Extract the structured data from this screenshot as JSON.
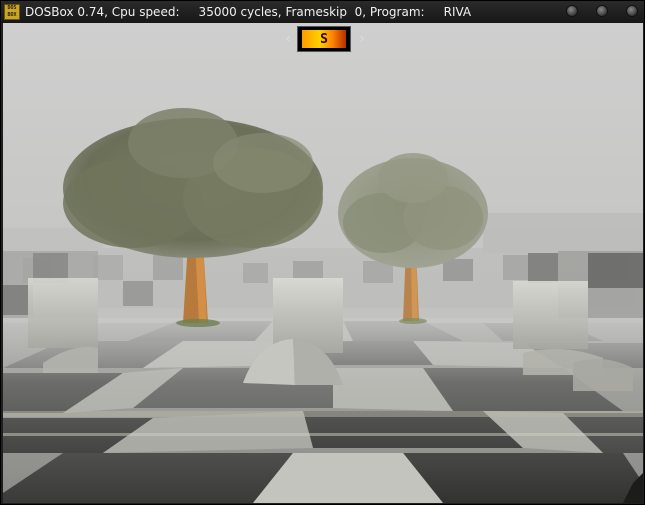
{
  "window": {
    "icon_text_top": "DOS",
    "icon_text_bottom": "BOX",
    "title": "DOSBox 0.74, Cpu speed:     35000 cycles, Frameskip  0, Program:     RIVA"
  },
  "hud": {
    "indicator": "S"
  },
  "colors": {
    "fog": "#c8c8c8",
    "tile_dark": "#3a3a3a",
    "tile_light": "#9a9a96",
    "hud_accent": "#ffb000"
  }
}
